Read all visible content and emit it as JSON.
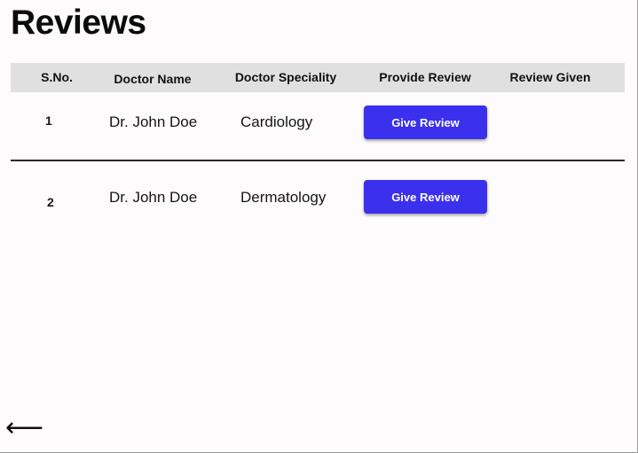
{
  "page": {
    "title": "Reviews"
  },
  "table": {
    "headers": {
      "sno": "S.No.",
      "doctor_name": "Doctor Name",
      "speciality": "Doctor Speciality",
      "provide_review": "Provide Review",
      "review_given": "Review Given"
    },
    "rows": [
      {
        "sno": "1",
        "doctor_name": "Dr. John Doe",
        "speciality": "Cardiology",
        "action_label": "Give Review",
        "review_given": ""
      },
      {
        "sno": "2",
        "doctor_name": "Dr. John Doe",
        "speciality": "Dermatology",
        "action_label": "Give Review",
        "review_given": ""
      }
    ]
  },
  "navigation": {
    "back_icon": "left-arrow-icon",
    "back_glyph": "⟵"
  },
  "colors": {
    "accent": "#3b30ee",
    "header_bg": "#e0e0e0",
    "page_bg": "#fdfbfb"
  }
}
